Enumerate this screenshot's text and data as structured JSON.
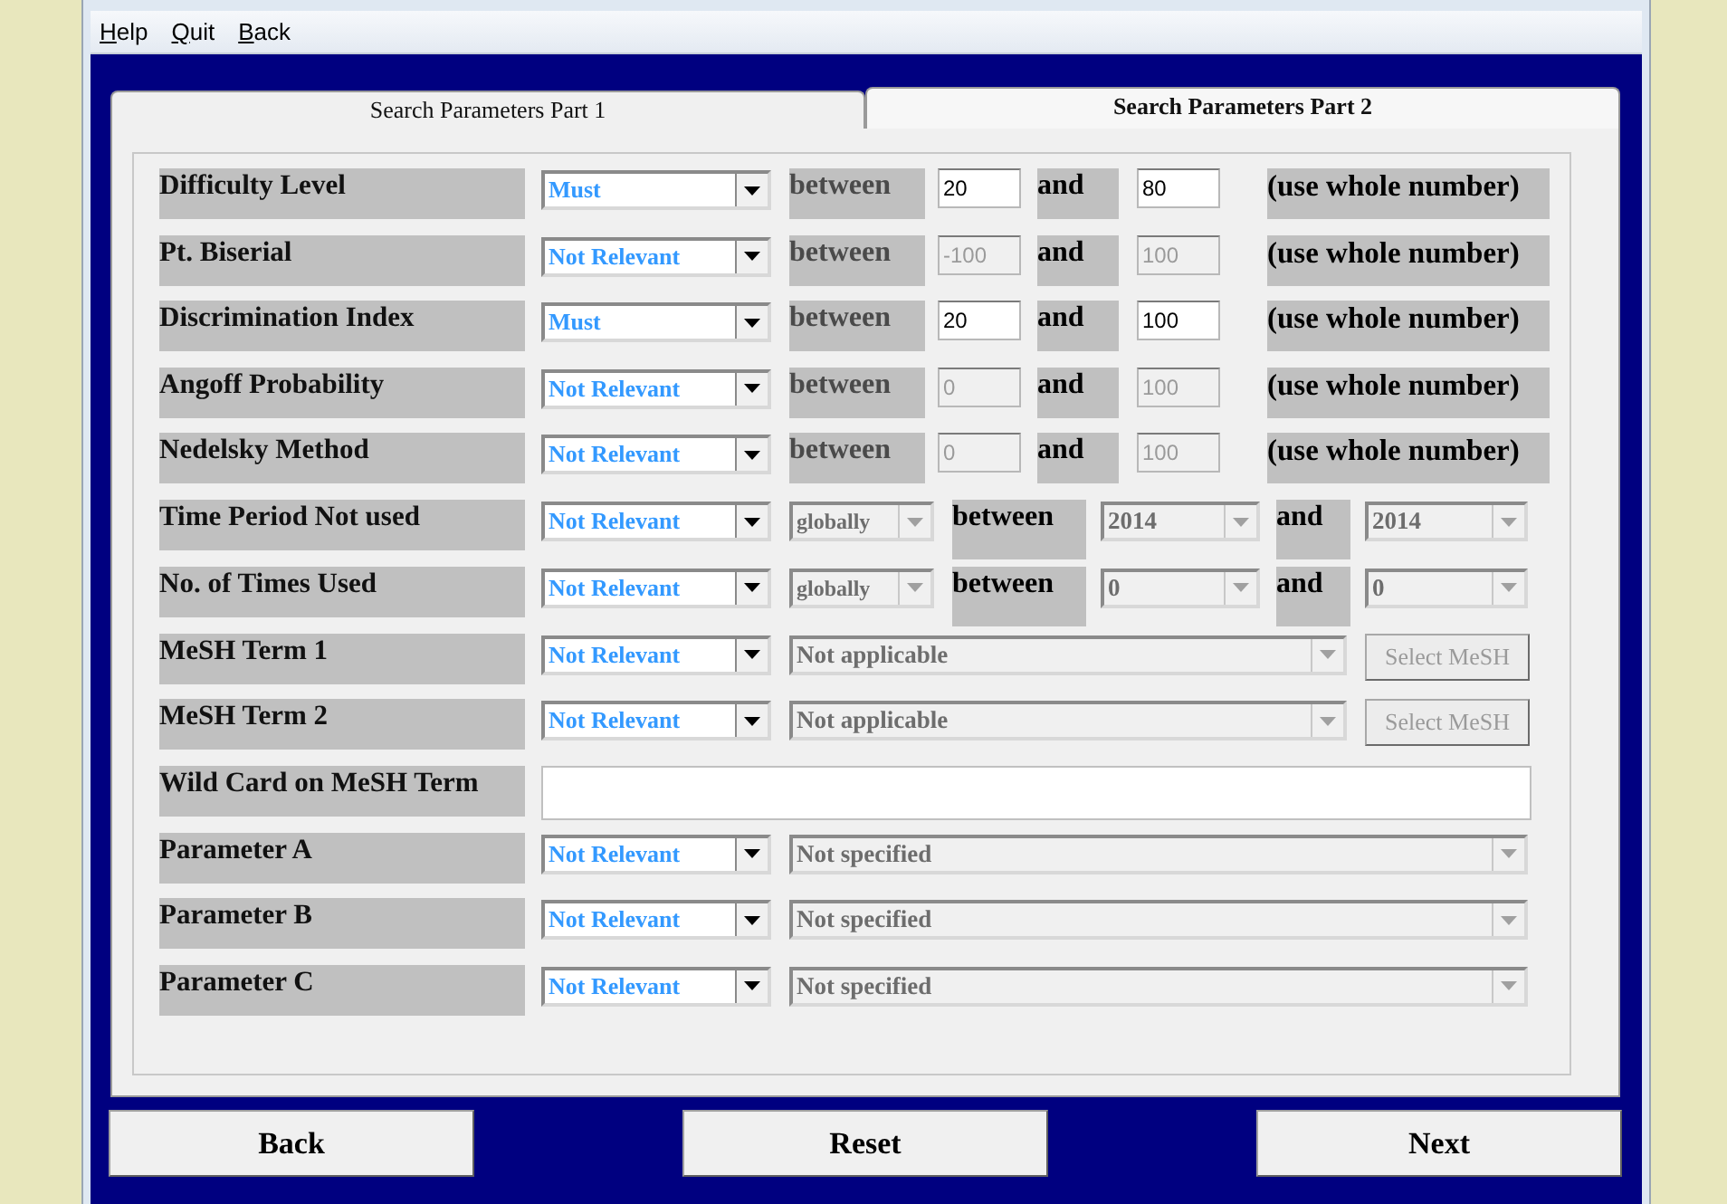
{
  "menu": [
    {
      "key": "H",
      "rest": "elp"
    },
    {
      "key": "Q",
      "rest": "uit"
    },
    {
      "key": "B",
      "rest": "ack"
    }
  ],
  "tabs": [
    {
      "label": "Search Parameters Part 1",
      "selected": false
    },
    {
      "label": "Search Parameters Part 2",
      "selected": true
    }
  ],
  "groups": [
    [
      {
        "kind": "range",
        "label": "Difficulty Level",
        "mode": "Must",
        "between": "between",
        "min": {
          "value": "20",
          "disabled": false
        },
        "and": "and",
        "max": {
          "value": "80",
          "disabled": false
        },
        "hint": "(use whole number)"
      },
      {
        "kind": "range",
        "label": "Pt. Biserial",
        "mode": "Not Relevant",
        "between": "between",
        "min": {
          "value": "-100",
          "disabled": true
        },
        "and": "and",
        "max": {
          "value": "100",
          "disabled": true
        },
        "hint": "(use whole number)"
      },
      {
        "kind": "range",
        "label": "Discrimination Index",
        "mode": "Must",
        "between": "between",
        "min": {
          "value": "20",
          "disabled": false
        },
        "and": "and",
        "max": {
          "value": "100",
          "disabled": false
        },
        "hint": "(use whole number)"
      },
      {
        "kind": "range",
        "label": "Angoff Probability",
        "mode": "Not Relevant",
        "between": "between",
        "min": {
          "value": "0",
          "disabled": true
        },
        "and": "and",
        "max": {
          "value": "100",
          "disabled": true
        },
        "hint": "(use whole number)"
      },
      {
        "kind": "range",
        "label": "Nedelsky Method",
        "mode": "Not Relevant",
        "between": "between",
        "min": {
          "value": "0",
          "disabled": true
        },
        "and": "and",
        "max": {
          "value": "100",
          "disabled": true
        },
        "hint": "(use whole number)"
      }
    ],
    [
      {
        "kind": "period",
        "label": "Time Period Not used",
        "mode": "Not Relevant",
        "scope": "globally",
        "between": "between",
        "from": "2014",
        "and": "and",
        "to": "2014"
      },
      {
        "kind": "period",
        "label": "No. of Times Used",
        "mode": "Not Relevant",
        "scope": "globally",
        "between": "between",
        "from": "0",
        "and": "and",
        "to": "0"
      }
    ],
    [
      {
        "kind": "mesh",
        "label": "MeSH Term 1",
        "mode": "Not Relevant",
        "term": "Not applicable",
        "button": "Select MeSH",
        "disabled": true
      },
      {
        "kind": "mesh",
        "label": "MeSH Term 2",
        "mode": "Not Relevant",
        "term": "Not applicable",
        "button": "Select MeSH",
        "disabled": true
      },
      {
        "kind": "wildcard",
        "label": "Wild Card on MeSH Term"
      }
    ],
    [
      {
        "kind": "param",
        "label": "Parameter A",
        "mode": "Not Relevant",
        "value": "Not specified"
      },
      {
        "kind": "param",
        "label": "Parameter B",
        "mode": "Not Relevant",
        "value": "Not specified"
      },
      {
        "kind": "param",
        "label": "Parameter C",
        "mode": "Not Relevant",
        "value": "Not specified"
      }
    ]
  ],
  "buttons": [
    "Back",
    "Reset",
    "Next"
  ]
}
